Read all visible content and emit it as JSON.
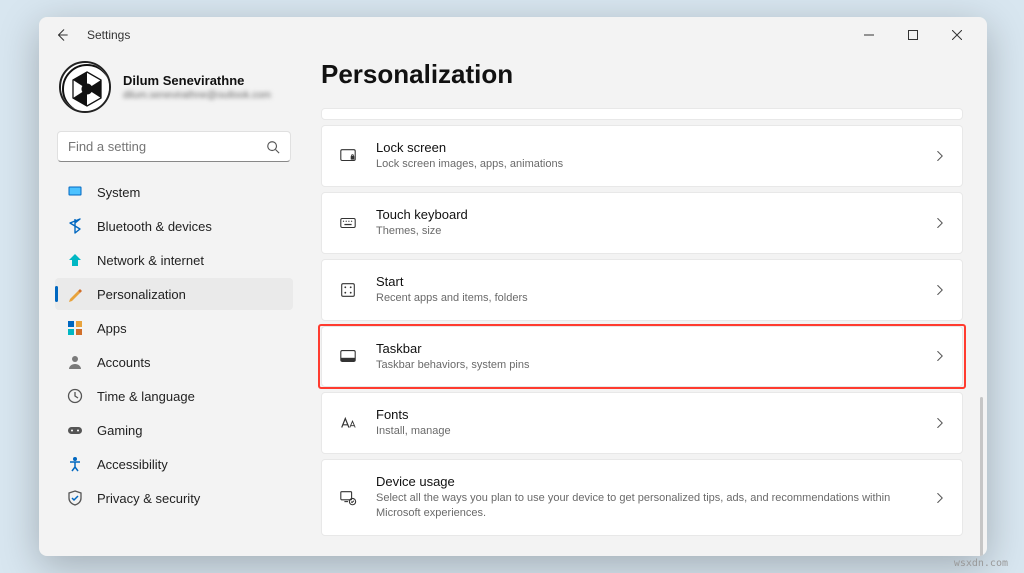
{
  "window": {
    "title": "Settings"
  },
  "profile": {
    "name": "Dilum Senevirathne",
    "email": "dilum.senevirathne@outlook.com"
  },
  "search": {
    "placeholder": "Find a setting"
  },
  "page": {
    "title": "Personalization"
  },
  "nav": [
    {
      "icon": "system-icon",
      "label": "System"
    },
    {
      "icon": "bluetooth-icon",
      "label": "Bluetooth & devices"
    },
    {
      "icon": "network-icon",
      "label": "Network & internet"
    },
    {
      "icon": "personalization-icon",
      "label": "Personalization",
      "selected": true
    },
    {
      "icon": "apps-icon",
      "label": "Apps"
    },
    {
      "icon": "accounts-icon",
      "label": "Accounts"
    },
    {
      "icon": "time-icon",
      "label": "Time & language"
    },
    {
      "icon": "gaming-icon",
      "label": "Gaming"
    },
    {
      "icon": "accessibility-icon",
      "label": "Accessibility"
    },
    {
      "icon": "privacy-icon",
      "label": "Privacy & security"
    }
  ],
  "cards": [
    {
      "icon": "lockscreen-icon",
      "title": "Lock screen",
      "sub": "Lock screen images, apps, animations"
    },
    {
      "icon": "touchkeyboard-icon",
      "title": "Touch keyboard",
      "sub": "Themes, size"
    },
    {
      "icon": "start-icon",
      "title": "Start",
      "sub": "Recent apps and items, folders"
    },
    {
      "icon": "taskbar-icon",
      "title": "Taskbar",
      "sub": "Taskbar behaviors, system pins",
      "highlight": true
    },
    {
      "icon": "fonts-icon",
      "title": "Fonts",
      "sub": "Install, manage"
    },
    {
      "icon": "deviceusage-icon",
      "title": "Device usage",
      "sub": "Select all the ways you plan to use your device to get personalized tips, ads, and recommendations within Microsoft experiences."
    }
  ],
  "watermark": "wsxdn.com"
}
